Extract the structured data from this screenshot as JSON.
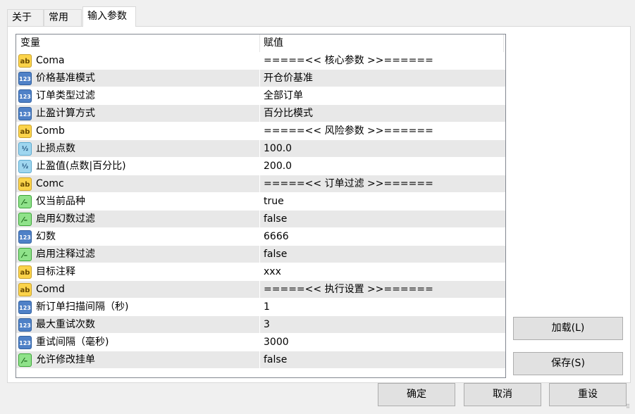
{
  "tabs": [
    {
      "label": "关于",
      "active": false
    },
    {
      "label": "常用",
      "active": false
    },
    {
      "label": "输入参数",
      "active": true
    }
  ],
  "grid": {
    "headers": {
      "variable": "变量",
      "value": "赋值"
    },
    "rows": [
      {
        "icon": "string-icon",
        "type": "ab",
        "name": "Coma",
        "value": "=====<< 核心参数 >>======"
      },
      {
        "icon": "integer-icon",
        "type": "n123",
        "name": "价格基准模式",
        "value": "开仓价基准"
      },
      {
        "icon": "integer-icon",
        "type": "n123",
        "name": "订单类型过滤",
        "value": "全部订单"
      },
      {
        "icon": "integer-icon",
        "type": "n123",
        "name": "止盈计算方式",
        "value": "百分比模式"
      },
      {
        "icon": "string-icon",
        "type": "ab",
        "name": "Comb",
        "value": "=====<< 风险参数 >>======"
      },
      {
        "icon": "double-icon",
        "type": "frac",
        "name": "止损点数",
        "value": "100.0"
      },
      {
        "icon": "double-icon",
        "type": "frac",
        "name": "止盈值(点数|百分比)",
        "value": "200.0"
      },
      {
        "icon": "string-icon",
        "type": "ab",
        "name": "Comc",
        "value": "=====<< 订单过滤 >>======"
      },
      {
        "icon": "bool-icon",
        "type": "bool",
        "name": "仅当前品种",
        "value": "true"
      },
      {
        "icon": "bool-icon",
        "type": "bool",
        "name": "启用幻数过滤",
        "value": "false"
      },
      {
        "icon": "integer-icon",
        "type": "n123",
        "name": "幻数",
        "value": "6666"
      },
      {
        "icon": "bool-icon",
        "type": "bool",
        "name": "启用注释过滤",
        "value": "false"
      },
      {
        "icon": "string-icon",
        "type": "ab",
        "name": "目标注释",
        "value": "xxx"
      },
      {
        "icon": "string-icon",
        "type": "ab",
        "name": "Comd",
        "value": "=====<< 执行设置 >>======"
      },
      {
        "icon": "integer-icon",
        "type": "n123",
        "name": "新订单扫描间隔（秒)",
        "value": "1"
      },
      {
        "icon": "integer-icon",
        "type": "n123",
        "name": "最大重试次数",
        "value": "3"
      },
      {
        "icon": "integer-icon",
        "type": "n123",
        "name": "重试间隔（毫秒)",
        "value": "3000"
      },
      {
        "icon": "bool-icon",
        "type": "bool",
        "name": "允许修改挂单",
        "value": "false"
      }
    ]
  },
  "buttons": {
    "load": "加载(L)",
    "save": "保存(S)",
    "ok": "确定",
    "cancel": "取消",
    "reset": "重设"
  },
  "icon_glyphs": {
    "ab": "ab",
    "n123": "123",
    "frac": "½",
    "bool": "⁄–"
  }
}
